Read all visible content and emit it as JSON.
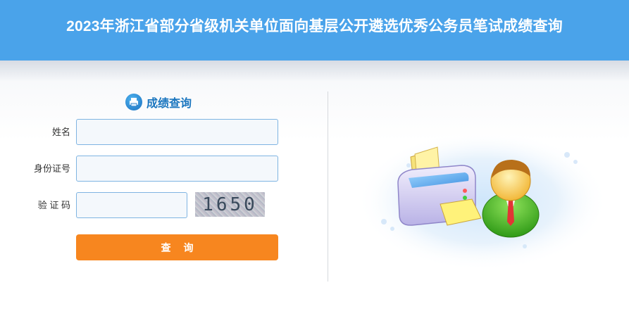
{
  "header": {
    "title": "2023年浙江省部分省级机关单位面向基层公开遴选优秀公务员笔试成绩查询"
  },
  "form": {
    "title": "成绩查询",
    "name_label": "姓名",
    "name_value": "",
    "id_label": "身份证号",
    "id_value": "",
    "captcha_label": "验 证 码",
    "captcha_value": "",
    "captcha_text": "1650",
    "submit_label": "查询"
  },
  "colors": {
    "header_bg": "#4aa3ea",
    "button": "#f7861f",
    "title": "#1b76bf",
    "input_border": "#7fb4e2"
  },
  "icons": {
    "title_icon": "printer-icon",
    "illustration": "printer-user-illustration"
  }
}
